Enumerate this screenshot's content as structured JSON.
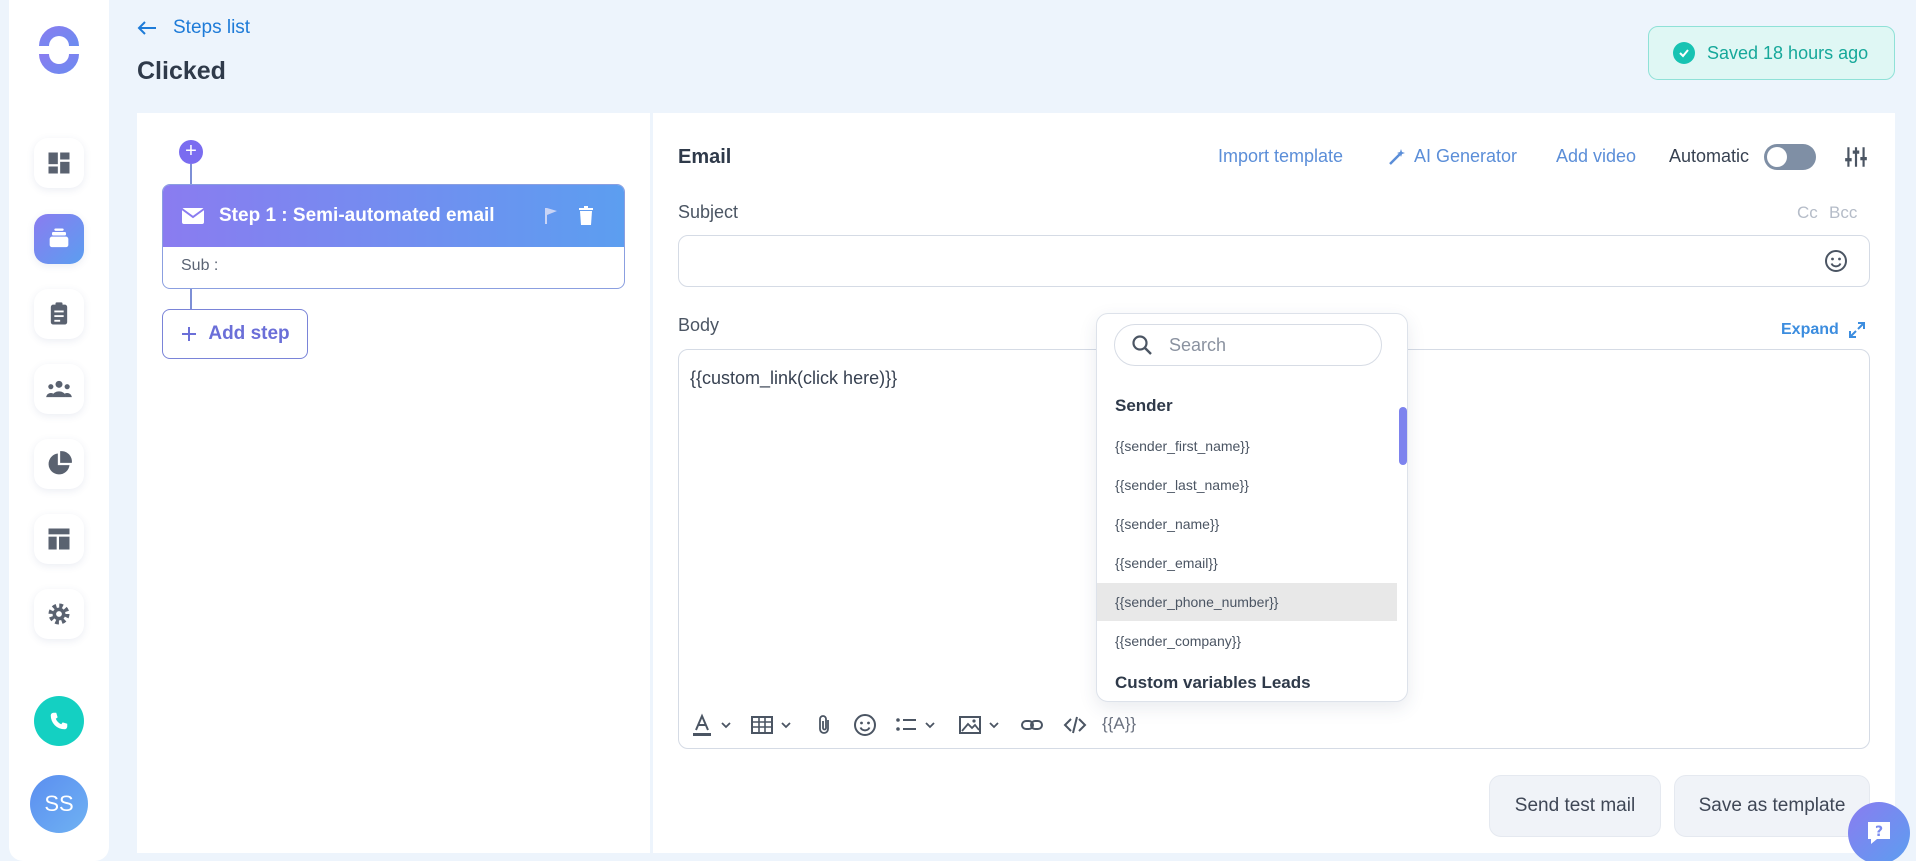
{
  "header": {
    "back_label": "Steps list",
    "title": "Clicked",
    "saved_status": "Saved 18 hours ago"
  },
  "sidebar": {
    "items": [
      {
        "icon": "dashboard-icon"
      },
      {
        "icon": "sequences-icon",
        "active": true
      },
      {
        "icon": "clipboard-icon"
      },
      {
        "icon": "team-icon"
      },
      {
        "icon": "pie-chart-icon"
      },
      {
        "icon": "layout-icon"
      },
      {
        "icon": "gear-icon"
      }
    ],
    "avatar_initials": "SS"
  },
  "steps": {
    "step_title": "Step 1 : Semi-automated email",
    "step_sub": "Sub :",
    "add_step_label": "Add step"
  },
  "email": {
    "label": "Email",
    "import_template": "Import template",
    "ai_generator": "AI Generator",
    "add_video": "Add video",
    "automatic_label": "Automatic",
    "subject_label": "Subject",
    "cc": "Cc",
    "bcc": "Bcc",
    "subject_value": "",
    "body_label": "Body",
    "expand_label": "Expand",
    "body_text": "{{custom_link(click here)}}",
    "var_button": "{{A}}",
    "send_test": "Send test mail",
    "save_template": "Save as template"
  },
  "dropdown": {
    "search_placeholder": "Search",
    "section_sender": "Sender",
    "items": [
      "{{sender_first_name}}",
      "{{sender_last_name}}",
      "{{sender_name}}",
      "{{sender_email}}",
      "{{sender_phone_number}}",
      "{{sender_company}}"
    ],
    "section_custom": "Custom variables Leads"
  },
  "colors": {
    "accent_purple": "#8a7cf0",
    "accent_blue": "#5c9ef0",
    "saved_green": "#16a89a",
    "link_blue": "#1e7bd8"
  }
}
